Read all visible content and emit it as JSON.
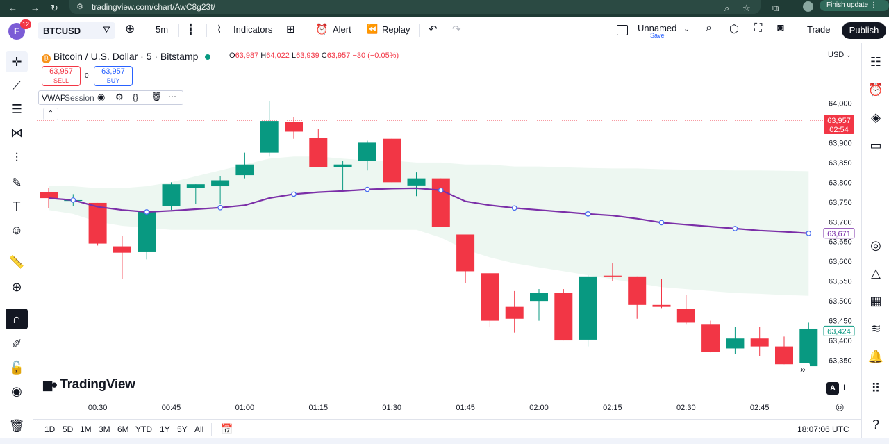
{
  "browser": {
    "url": "tradingview.com/chart/AwC8g23t/",
    "finish_update": "Finish update"
  },
  "topbar": {
    "avatar_letter": "F",
    "avatar_badge": "12",
    "symbol": "BTCUSD",
    "interval": "5m",
    "indicators": "Indicators",
    "alert": "Alert",
    "replay": "Replay",
    "layout_name": "Unnamed",
    "layout_save": "Save",
    "trade": "Trade",
    "publish": "Publish"
  },
  "legend": {
    "title": "Bitcoin / U.S. Dollar · 5 · Bitstamp",
    "open_key": "O",
    "open": "63,987",
    "high_key": "H",
    "high": "64,022",
    "low_key": "L",
    "low": "63,939",
    "close_key": "C",
    "close": "63,957",
    "change": "−30 (−0.05%)",
    "sell_price": "63,957",
    "sell_label": "SELL",
    "spread": "0",
    "buy_price": "63,957",
    "buy_label": "BUY",
    "indicator_name": "VWAP",
    "indicator_param": "Session"
  },
  "watermark": "TradingView",
  "price_axis": {
    "currency": "USD",
    "current_price": "63,957",
    "countdown": "02:54",
    "vwap_label": "63,671",
    "crosshair_label": "63,424"
  },
  "bottom": {
    "ranges": [
      "1D",
      "5D",
      "1M",
      "3M",
      "6M",
      "YTD",
      "1Y",
      "5Y",
      "All"
    ],
    "clock": "18:07:06 UTC",
    "auto_label": "A",
    "log_label": "L"
  },
  "colors": {
    "up": "#089981",
    "down": "#f23645",
    "vwap": "#7b2fa8",
    "band": "#e8f5ee",
    "accent": "#2962ff"
  },
  "chart_data": {
    "type": "candlestick",
    "ylim": [
      63300,
      64050
    ],
    "y_ticks": [
      {
        "value": 64000,
        "label": "64,000"
      },
      {
        "value": 63900,
        "label": "63,900"
      },
      {
        "value": 63850,
        "label": "63,850"
      },
      {
        "value": 63800,
        "label": "63,800"
      },
      {
        "value": 63750,
        "label": "63,750"
      },
      {
        "value": 63700,
        "label": "63,700"
      },
      {
        "value": 63650,
        "label": "63,650"
      },
      {
        "value": 63600,
        "label": "63,600"
      },
      {
        "value": 63550,
        "label": "63,550"
      },
      {
        "value": 63500,
        "label": "63,500"
      },
      {
        "value": 63450,
        "label": "63,450"
      },
      {
        "value": 63400,
        "label": "63,400"
      },
      {
        "value": 63350,
        "label": "63,350"
      }
    ],
    "x_ticks": [
      {
        "index": 2,
        "label": "00:30"
      },
      {
        "index": 5,
        "label": "00:45"
      },
      {
        "index": 8,
        "label": "01:00"
      },
      {
        "index": 11,
        "label": "01:15"
      },
      {
        "index": 14,
        "label": "01:30"
      },
      {
        "index": 17,
        "label": "01:45"
      },
      {
        "index": 20,
        "label": "02:00"
      },
      {
        "index": 23,
        "label": "02:15"
      },
      {
        "index": 26,
        "label": "02:30"
      },
      {
        "index": 29,
        "label": "02:45"
      }
    ],
    "candles": [
      {
        "o": 63775,
        "h": 63785,
        "l": 63735,
        "c": 63760
      },
      {
        "o": 63755,
        "h": 63770,
        "l": 63740,
        "c": 63755
      },
      {
        "o": 63748,
        "h": 63748,
        "l": 63640,
        "c": 63645
      },
      {
        "o": 63638,
        "h": 63665,
        "l": 63555,
        "c": 63622
      },
      {
        "o": 63625,
        "h": 63730,
        "l": 63605,
        "c": 63725
      },
      {
        "o": 63740,
        "h": 63800,
        "l": 63730,
        "c": 63795
      },
      {
        "o": 63785,
        "h": 63795,
        "l": 63745,
        "c": 63795
      },
      {
        "o": 63790,
        "h": 63815,
        "l": 63745,
        "c": 63805
      },
      {
        "o": 63818,
        "h": 63875,
        "l": 63810,
        "c": 63845
      },
      {
        "o": 63875,
        "h": 64005,
        "l": 63865,
        "c": 63955
      },
      {
        "o": 63952,
        "h": 63965,
        "l": 63910,
        "c": 63928
      },
      {
        "o": 63912,
        "h": 63935,
        "l": 63840,
        "c": 63838
      },
      {
        "o": 63838,
        "h": 63855,
        "l": 63780,
        "c": 63845
      },
      {
        "o": 63855,
        "h": 63905,
        "l": 63830,
        "c": 63900
      },
      {
        "o": 63910,
        "h": 63910,
        "l": 63800,
        "c": 63800
      },
      {
        "o": 63792,
        "h": 63825,
        "l": 63765,
        "c": 63810
      },
      {
        "o": 63810,
        "h": 63810,
        "l": 63690,
        "c": 63688
      },
      {
        "o": 63668,
        "h": 63668,
        "l": 63545,
        "c": 63575
      },
      {
        "o": 63570,
        "h": 63570,
        "l": 63435,
        "c": 63450
      },
      {
        "o": 63485,
        "h": 63525,
        "l": 63420,
        "c": 63455
      },
      {
        "o": 63500,
        "h": 63530,
        "l": 63450,
        "c": 63520
      },
      {
        "o": 63520,
        "h": 63530,
        "l": 63400,
        "c": 63400
      },
      {
        "o": 63402,
        "h": 63565,
        "l": 63385,
        "c": 63562
      },
      {
        "o": 63564,
        "h": 63595,
        "l": 63550,
        "c": 63562
      },
      {
        "o": 63562,
        "h": 63562,
        "l": 63455,
        "c": 63490
      },
      {
        "o": 63490,
        "h": 63555,
        "l": 63482,
        "c": 63485
      },
      {
        "o": 63480,
        "h": 63515,
        "l": 63440,
        "c": 63445
      },
      {
        "o": 63440,
        "h": 63450,
        "l": 63370,
        "c": 63372
      },
      {
        "o": 63380,
        "h": 63435,
        "l": 63365,
        "c": 63405
      },
      {
        "o": 63405,
        "h": 63435,
        "l": 63360,
        "c": 63385
      },
      {
        "o": 63385,
        "h": 63410,
        "l": 63340,
        "c": 63340
      },
      {
        "o": 63335,
        "h": 63445,
        "l": 63330,
        "c": 63430
      }
    ],
    "vwap": [
      63760,
      63755,
      63738,
      63730,
      63725,
      63728,
      63732,
      63736,
      63742,
      63760,
      63770,
      63775,
      63778,
      63782,
      63784,
      63785,
      63780,
      63752,
      63742,
      63735,
      63730,
      63725,
      63720,
      63716,
      63708,
      63698,
      63693,
      63688,
      63683,
      63678,
      63675,
      63671
    ],
    "vwap_upper": [
      63790,
      63790,
      63785,
      63785,
      63790,
      63800,
      63815,
      63830,
      63845,
      63860,
      63865,
      63865,
      63860,
      63855,
      63855,
      63850,
      63850,
      63845,
      63845,
      63840,
      63840,
      63838,
      63836,
      63835,
      63835,
      63833,
      63832,
      63831,
      63830,
      63830,
      63829,
      63828
    ],
    "vwap_lower": [
      63730,
      63720,
      63700,
      63690,
      63685,
      63680,
      63680,
      63680,
      63680,
      63680,
      63680,
      63680,
      63680,
      63680,
      63680,
      63680,
      63660,
      63630,
      63610,
      63595,
      63585,
      63575,
      63565,
      63555,
      63545,
      63535,
      63530,
      63525,
      63520,
      63518,
      63515,
      63513
    ]
  }
}
